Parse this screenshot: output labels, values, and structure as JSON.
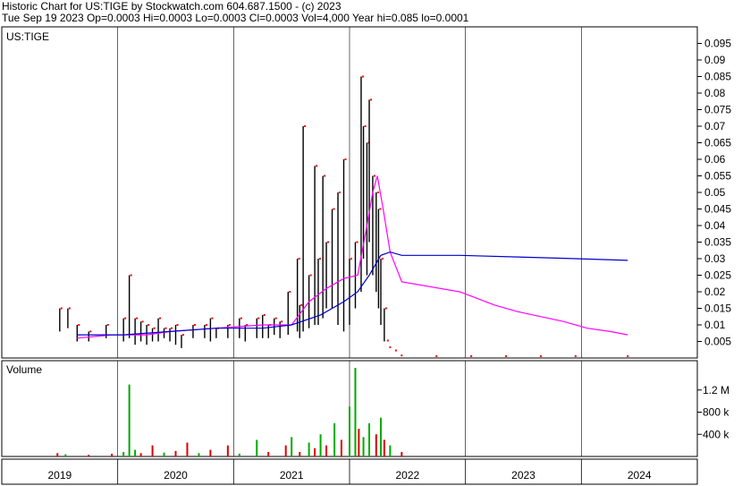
{
  "header": {
    "line1": "Historic Chart for US:TIGE by Stockwatch.com 604.687.1500 - (c) 2023",
    "line2": "Tue Sep 19 2023  Op=0.0003  Hi=0.0003  Lo=0.0003  Cl=0.0003  Vol=4,000  Year hi=0.085  lo=0.0001"
  },
  "colors": {
    "price_bar": "#000000",
    "down_tick": "#ff0000",
    "ma_short": "#ff00ff",
    "ma_long": "#0000cc",
    "vol_up": "#00aa00",
    "vol_down": "#dd0000",
    "grid": "#000000",
    "frame": "#000000"
  },
  "chart_data": [
    {
      "type": "ohlc",
      "title": "US:TIGE",
      "ylim": [
        0,
        0.1
      ],
      "y_ticks": [
        "0.005",
        "0.01",
        "0.015",
        "0.02",
        "0.025",
        "0.03",
        "0.035",
        "0.04",
        "0.045",
        "0.05",
        "0.055",
        "0.06",
        "0.065",
        "0.07",
        "0.075",
        "0.08",
        "0.085",
        "0.09",
        "0.095"
      ],
      "x_ticks": [
        "2019",
        "2020",
        "2021",
        "2022",
        "2023",
        "2024"
      ],
      "grid": true,
      "series": [
        {
          "name": "",
          "kind": "price_bars",
          "points": [
            [
              2019.05,
              0.008,
              0.015
            ],
            [
              2019.12,
              0.009,
              0.015
            ],
            [
              2019.2,
              0.005,
              0.01
            ],
            [
              2019.3,
              0.005,
              0.008
            ],
            [
              2019.45,
              0.006,
              0.01
            ],
            [
              2019.6,
              0.005,
              0.012
            ],
            [
              2019.65,
              0.006,
              0.025
            ],
            [
              2019.7,
              0.004,
              0.012
            ],
            [
              2019.75,
              0.005,
              0.011
            ],
            [
              2019.8,
              0.004,
              0.01
            ],
            [
              2019.85,
              0.005,
              0.009
            ],
            [
              2019.9,
              0.005,
              0.012
            ],
            [
              2019.95,
              0.006,
              0.009
            ],
            [
              2020.0,
              0.005,
              0.009
            ],
            [
              2020.05,
              0.004,
              0.01
            ],
            [
              2020.1,
              0.003,
              0.007
            ],
            [
              2020.2,
              0.006,
              0.01
            ],
            [
              2020.3,
              0.006,
              0.01
            ],
            [
              2020.35,
              0.005,
              0.012
            ],
            [
              2020.4,
              0.006,
              0.009
            ],
            [
              2020.5,
              0.006,
              0.01
            ],
            [
              2020.6,
              0.006,
              0.012
            ],
            [
              2020.65,
              0.005,
              0.01
            ],
            [
              2020.75,
              0.006,
              0.012
            ],
            [
              2020.8,
              0.006,
              0.013
            ],
            [
              2020.85,
              0.006,
              0.01
            ],
            [
              2020.9,
              0.007,
              0.012
            ],
            [
              2020.95,
              0.006,
              0.011
            ],
            [
              2021.02,
              0.007,
              0.02
            ],
            [
              2021.1,
              0.008,
              0.03
            ],
            [
              2021.12,
              0.006,
              0.016
            ],
            [
              2021.15,
              0.008,
              0.07
            ],
            [
              2021.2,
              0.009,
              0.025
            ],
            [
              2021.25,
              0.01,
              0.058
            ],
            [
              2021.28,
              0.01,
              0.03
            ],
            [
              2021.32,
              0.012,
              0.055
            ],
            [
              2021.35,
              0.015,
              0.035
            ],
            [
              2021.4,
              0.015,
              0.045
            ],
            [
              2021.45,
              0.01,
              0.05
            ],
            [
              2021.5,
              0.008,
              0.06
            ],
            [
              2021.55,
              0.01,
              0.03
            ],
            [
              2021.6,
              0.015,
              0.035
            ],
            [
              2021.65,
              0.02,
              0.085
            ],
            [
              2021.67,
              0.03,
              0.07
            ],
            [
              2021.7,
              0.025,
              0.065
            ],
            [
              2021.72,
              0.035,
              0.078
            ],
            [
              2021.75,
              0.025,
              0.055
            ],
            [
              2021.78,
              0.02,
              0.05
            ],
            [
              2021.8,
              0.015,
              0.045
            ],
            [
              2021.82,
              0.01,
              0.03
            ],
            [
              2021.85,
              0.005,
              0.015
            ]
          ]
        },
        {
          "name": "",
          "kind": "line",
          "points": [
            [
              2019.2,
              0.006
            ],
            [
              2019.5,
              0.007
            ],
            [
              2019.8,
              0.007
            ],
            [
              2020.0,
              0.008
            ],
            [
              2020.4,
              0.009
            ],
            [
              2020.8,
              0.01
            ],
            [
              2021.05,
              0.01
            ],
            [
              2021.2,
              0.017
            ],
            [
              2021.35,
              0.021
            ],
            [
              2021.5,
              0.024
            ],
            [
              2021.62,
              0.025
            ],
            [
              2021.7,
              0.04
            ],
            [
              2021.75,
              0.05
            ],
            [
              2021.79,
              0.055
            ],
            [
              2021.84,
              0.045
            ],
            [
              2021.9,
              0.032
            ],
            [
              2022.0,
              0.023
            ],
            [
              2022.5,
              0.02
            ],
            [
              2022.8,
              0.016
            ],
            [
              2023.0,
              0.014
            ],
            [
              2023.4,
              0.011
            ],
            [
              2023.6,
              0.009
            ],
            [
              2023.8,
              0.008
            ],
            [
              2023.95,
              0.007
            ]
          ]
        },
        {
          "name": "",
          "kind": "line",
          "points": [
            [
              2019.2,
              0.007
            ],
            [
              2019.6,
              0.007
            ],
            [
              2020.0,
              0.008
            ],
            [
              2020.4,
              0.009
            ],
            [
              2020.8,
              0.009
            ],
            [
              2021.05,
              0.01
            ],
            [
              2021.3,
              0.013
            ],
            [
              2021.5,
              0.017
            ],
            [
              2021.62,
              0.02
            ],
            [
              2021.72,
              0.025
            ],
            [
              2021.82,
              0.031
            ],
            [
              2021.9,
              0.032
            ],
            [
              2022.0,
              0.031
            ],
            [
              2022.5,
              0.031
            ],
            [
              2023.0,
              0.0305
            ],
            [
              2023.5,
              0.03
            ],
            [
              2023.95,
              0.0295
            ]
          ]
        },
        {
          "name": "",
          "kind": "dots_low",
          "points": [
            [
              2021.88,
              0.005
            ],
            [
              2021.9,
              0.003
            ],
            [
              2021.95,
              0.002
            ],
            [
              2022.0,
              0.0005
            ],
            [
              2022.3,
              0.0003
            ],
            [
              2022.6,
              0.0003
            ],
            [
              2022.9,
              0.0003
            ],
            [
              2023.2,
              0.0003
            ],
            [
              2023.5,
              0.0003
            ],
            [
              2023.95,
              0.0003
            ]
          ]
        }
      ]
    },
    {
      "type": "bar",
      "title": "Volume",
      "ylim": [
        0,
        1600000
      ],
      "y_ticks": [
        "400 k",
        "800 k",
        "1.2 M"
      ],
      "series": [
        {
          "name": "",
          "kind": "volume",
          "points": [
            [
              2019.03,
              60000,
              "d"
            ],
            [
              2019.1,
              40000,
              "u"
            ],
            [
              2019.3,
              30000,
              "d"
            ],
            [
              2019.5,
              50000,
              "d"
            ],
            [
              2019.6,
              80000,
              "u"
            ],
            [
              2019.65,
              1300000,
              "u"
            ],
            [
              2019.7,
              120000,
              "u"
            ],
            [
              2019.75,
              60000,
              "d"
            ],
            [
              2019.85,
              200000,
              "d"
            ],
            [
              2019.95,
              70000,
              "u"
            ],
            [
              2020.05,
              100000,
              "d"
            ],
            [
              2020.15,
              250000,
              "d"
            ],
            [
              2020.25,
              60000,
              "u"
            ],
            [
              2020.35,
              120000,
              "d"
            ],
            [
              2020.5,
              200000,
              "d"
            ],
            [
              2020.6,
              50000,
              "u"
            ],
            [
              2020.75,
              300000,
              "u"
            ],
            [
              2020.85,
              80000,
              "d"
            ],
            [
              2021.0,
              200000,
              "d"
            ],
            [
              2021.05,
              350000,
              "u"
            ],
            [
              2021.12,
              80000,
              "d"
            ],
            [
              2021.2,
              250000,
              "u"
            ],
            [
              2021.25,
              150000,
              "d"
            ],
            [
              2021.3,
              400000,
              "u"
            ],
            [
              2021.35,
              200000,
              "d"
            ],
            [
              2021.42,
              600000,
              "u"
            ],
            [
              2021.48,
              300000,
              "d"
            ],
            [
              2021.55,
              900000,
              "u"
            ],
            [
              2021.6,
              1600000,
              "u"
            ],
            [
              2021.63,
              500000,
              "d"
            ],
            [
              2021.67,
              350000,
              "u"
            ],
            [
              2021.72,
              600000,
              "u"
            ],
            [
              2021.78,
              400000,
              "d"
            ],
            [
              2021.82,
              700000,
              "u"
            ],
            [
              2021.85,
              300000,
              "d"
            ],
            [
              2021.9,
              200000,
              "u"
            ],
            [
              2022.0,
              80000,
              "d"
            ]
          ]
        }
      ]
    }
  ]
}
